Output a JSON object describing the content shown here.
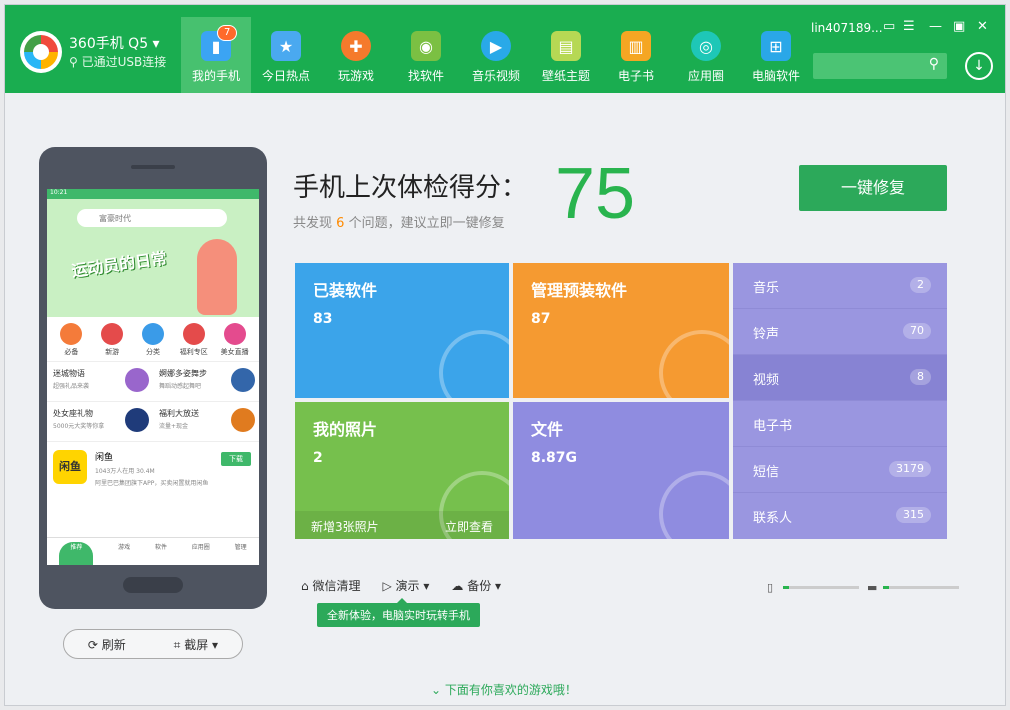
{
  "header": {
    "device": "360手机 Q5",
    "usb_status": "已通过USB连接",
    "user": "lin407189...",
    "tabs": [
      {
        "label": "我的手机",
        "badge": "7",
        "color": "#3ba4f3"
      },
      {
        "label": "今日热点",
        "color": "#4aa9f0"
      },
      {
        "label": "玩游戏",
        "color": "#f57a2c"
      },
      {
        "label": "找软件",
        "color": "#7bc043"
      },
      {
        "label": "音乐视频",
        "color": "#29a9e8"
      },
      {
        "label": "壁纸主题",
        "color": "#b6d854"
      },
      {
        "label": "电子书",
        "color": "#f5a623"
      },
      {
        "label": "应用圈",
        "color": "#1ec7b7"
      },
      {
        "label": "电脑软件",
        "color": "#2aa7e8"
      }
    ]
  },
  "phone_screen": {
    "status": "10:21",
    "search_placeholder": "富豪时代",
    "banner": "运动员的日常",
    "categories": [
      {
        "label": "必备",
        "color": "#f47b3a"
      },
      {
        "label": "新游",
        "color": "#e44b4b"
      },
      {
        "label": "分类",
        "color": "#3a9be8"
      },
      {
        "label": "福利专区",
        "color": "#e44b4b"
      },
      {
        "label": "美女直播",
        "color": "#e44b8e"
      }
    ],
    "promos": [
      {
        "title": "迷城物语",
        "sub": "超强礼品来袭",
        "color": "#9966cc"
      },
      {
        "title": "婀娜多姿舞步",
        "sub": "舞蹈动感起舞吧",
        "color": "#3366aa"
      },
      {
        "title": "处女座礼物",
        "sub": "5000元大奖等你拿",
        "color": "#1f3b7a"
      },
      {
        "title": "福利大放送",
        "sub": "流量+现金",
        "color": "#e07b1f"
      }
    ],
    "app": {
      "icon": "闲鱼",
      "name": "闲鱼",
      "meta": "1043万人在用   30.4M",
      "desc": "阿里巴巴集团旗下APP，买卖闲置就用闲鱼",
      "button": "下载"
    },
    "tabs": [
      "推荐",
      "游戏",
      "软件",
      "应用圈",
      "管理"
    ]
  },
  "phone_actions": {
    "refresh": "刷新",
    "screenshot": "截屏"
  },
  "check": {
    "title": "手机上次体检得分：",
    "sub_prefix": "共发现",
    "issues": "6",
    "sub_suffix": "个问题，建议立即一键修复",
    "score": "75",
    "fix_button": "一键修复"
  },
  "tiles": [
    {
      "label": "已装软件",
      "value": "83",
      "color": "#3ba4ea"
    },
    {
      "label": "管理预装软件",
      "value": "87",
      "color": "#f59a31"
    },
    {
      "label": "我的照片",
      "value": "2",
      "color": "#76c04d",
      "foot_left": "新增3张照片",
      "foot_right": "立即查看"
    },
    {
      "label": "文件",
      "value": "8.87G",
      "color": "#8f8ce0"
    }
  ],
  "media": [
    {
      "label": "音乐",
      "count": "2"
    },
    {
      "label": "铃声",
      "count": "70"
    },
    {
      "label": "视频",
      "count": "8"
    },
    {
      "label": "电子书",
      "count": ""
    },
    {
      "label": "短信",
      "count": "3179"
    },
    {
      "label": "联系人",
      "count": "315"
    }
  ],
  "toolbar": {
    "wechat": "微信清理",
    "demo": "演示",
    "backup": "备份"
  },
  "tooltip": "全新体验，电脑实时玩转手机",
  "storage": {
    "phone_fraction": 0.08,
    "sd_fraction": 0.08
  },
  "bottom_hint": "下面有你喜欢的游戏哦！"
}
